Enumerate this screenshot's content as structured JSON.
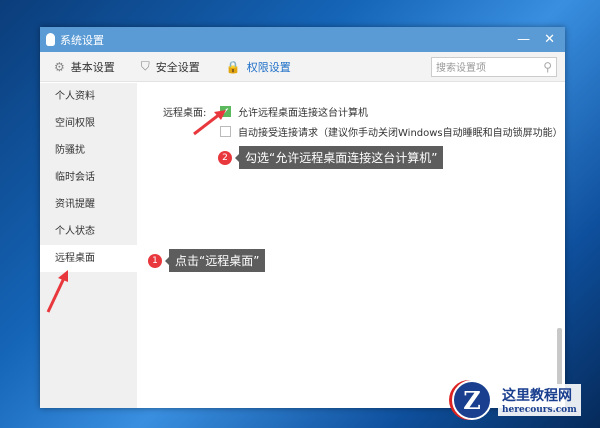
{
  "window": {
    "title": "系统设置",
    "minimize": "—",
    "close": "✕"
  },
  "toolbar": {
    "tabs": [
      {
        "label": "基本设置",
        "icon": "⚙"
      },
      {
        "label": "安全设置",
        "icon": "⛉"
      },
      {
        "label": "权限设置",
        "icon": "🔒"
      }
    ],
    "search_placeholder": "搜索设置项",
    "search_icon": "⚲"
  },
  "sidebar": {
    "items": [
      "个人资料",
      "空间权限",
      "防骚扰",
      "临时会话",
      "资讯提醒",
      "个人状态",
      "远程桌面"
    ],
    "selected": "远程桌面"
  },
  "content": {
    "label": "远程桌面:",
    "options": [
      {
        "text": "允许远程桌面连接这台计算机",
        "checked": true
      },
      {
        "text": "自动接受连接请求（建议你手动关闭Windows自动睡眠和自动锁屏功能）",
        "checked": false
      }
    ]
  },
  "callouts": [
    {
      "num": "1",
      "text": "点击“远程桌面”"
    },
    {
      "num": "2",
      "text": "勾选“允许远程桌面连接这台计算机”"
    }
  ],
  "watermark": {
    "letter": "Z",
    "name": "这里教程网",
    "url": "herecours.com"
  }
}
